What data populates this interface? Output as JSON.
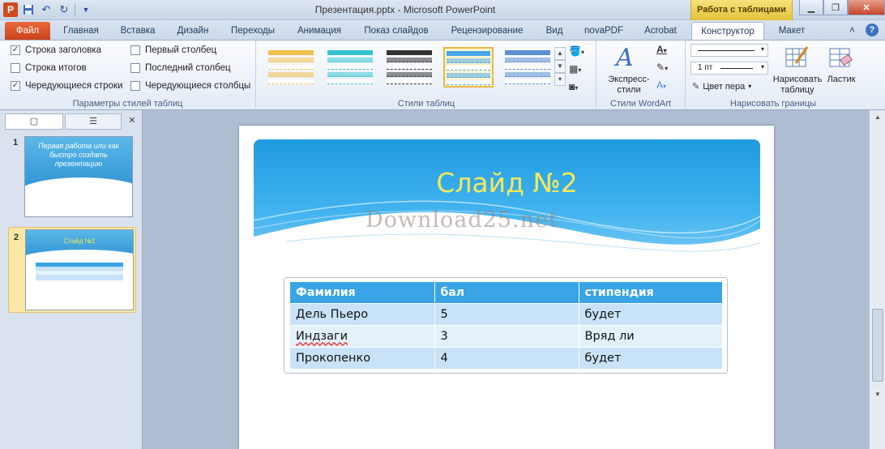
{
  "window": {
    "title": "Презентация.pptx - Microsoft PowerPoint",
    "context_tab_header": "Работа с таблицами",
    "app_logo": "P"
  },
  "tabs": [
    {
      "label": "Файл"
    },
    {
      "label": "Главная"
    },
    {
      "label": "Вставка"
    },
    {
      "label": "Дизайн"
    },
    {
      "label": "Переходы"
    },
    {
      "label": "Анимация"
    },
    {
      "label": "Показ слайдов"
    },
    {
      "label": "Рецензирование"
    },
    {
      "label": "Вид"
    },
    {
      "label": "novaPDF"
    },
    {
      "label": "Acrobat"
    },
    {
      "label": "Конструктор"
    },
    {
      "label": "Макет"
    }
  ],
  "ribbon": {
    "style_options": {
      "label": "Параметры стилей таблиц",
      "items": [
        {
          "label": "Строка заголовка",
          "checked": true
        },
        {
          "label": "Строка итогов",
          "checked": false
        },
        {
          "label": "Чередующиеся строки",
          "checked": true
        },
        {
          "label": "Первый столбец",
          "checked": false
        },
        {
          "label": "Последний столбец",
          "checked": false
        },
        {
          "label": "Чередующиеся столбцы",
          "checked": false
        }
      ]
    },
    "table_styles": {
      "label": "Стили таблиц",
      "swatch_colors": [
        "#f2c14e",
        "#32c4cf",
        "#333333",
        "#46a6e6",
        "#5b8fd0"
      ]
    },
    "wordart": {
      "label": "Стили WordArt",
      "express_label": "Экспресс-стили"
    },
    "draw_borders": {
      "label": "Нарисовать границы",
      "pen_weight": "1 пт",
      "pen_color_label": "Цвет пера",
      "draw_table_label": "Нарисовать таблицу",
      "eraser_label": "Ластик"
    }
  },
  "slides_panel": {
    "thumbnails": [
      {
        "number": "1",
        "title": "Первая работа или как быстро создать презентацию"
      },
      {
        "number": "2",
        "title": "Слайд №2"
      }
    ]
  },
  "slide": {
    "title": "Слайд №2",
    "watermark": "Download25.net",
    "table": {
      "headers": [
        "Фамилия",
        "бал",
        "стипендия"
      ],
      "rows": [
        [
          "Дель Пьеро",
          "5",
          "будет"
        ],
        [
          "Индзаги",
          "3",
          "Вряд ли"
        ],
        [
          "Прокопенко",
          "4",
          "будет"
        ]
      ]
    }
  },
  "colors": {
    "file_tab": "#d04a1e",
    "context_tab": "#e9c845",
    "slide_title": "#f3e85a",
    "table_header": "#39a4e6",
    "table_band": "#c8e3f7"
  }
}
